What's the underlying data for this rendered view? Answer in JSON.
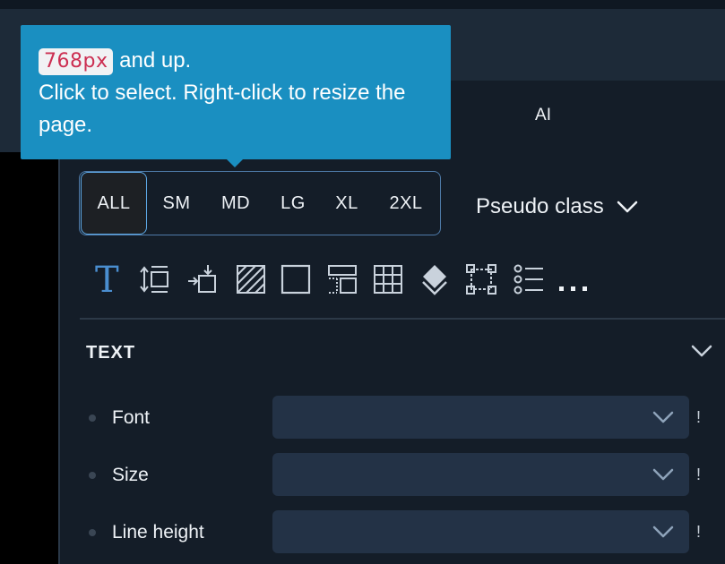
{
  "tooltip": {
    "badge": "768px",
    "line1_rest": " and up.",
    "line2": "Click to select. Right-click to resize the page."
  },
  "tabs": {
    "ai": "AI"
  },
  "breakpoints": [
    "ALL",
    "SM",
    "MD",
    "LG",
    "XL",
    "2XL"
  ],
  "pseudo_class": {
    "label": "Pseudo class"
  },
  "toolbar_icons": [
    "typography-icon",
    "spacing-icon",
    "position-icon",
    "background-icon",
    "border-icon",
    "layout-icon",
    "grid-icon",
    "effects-icon",
    "transform-icon",
    "list-icon",
    "more-icon"
  ],
  "section": {
    "title": "TEXT"
  },
  "properties": [
    {
      "label": "Font",
      "value": ""
    },
    {
      "label": "Size",
      "value": ""
    },
    {
      "label": "Line height",
      "value": ""
    }
  ],
  "colors": {
    "accent": "#1a8fc1",
    "badge_text": "#cc2f52",
    "active_border": "#5ea9e6"
  }
}
